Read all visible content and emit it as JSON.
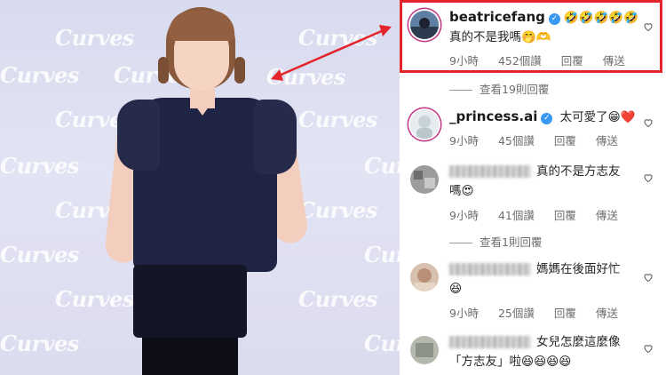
{
  "photo": {
    "watermark_text": "Curves",
    "description_colors": {
      "background": "#dcdcef",
      "shirt": "#1f2444"
    }
  },
  "highlight_color": "#e3242b",
  "comments": [
    {
      "username": "beatricefang",
      "verified": true,
      "text_prefix": "",
      "text": "真的不是我嗎",
      "emoji_after_name": "🤣🤣🤣🤣🤣",
      "emoji_after_text": "🤭🫶",
      "time": "9小時",
      "likes": "452個讚",
      "reply": "回覆",
      "send": "傳送"
    },
    {
      "view_replies": "查看19則回覆"
    },
    {
      "username": "_princess.ai",
      "verified": true,
      "text": "太可愛了",
      "emoji_after_text": "😁❤️",
      "time": "9小時",
      "likes": "45個讚",
      "reply": "回覆",
      "send": "傳送"
    },
    {
      "username_blurred": true,
      "text": "真的不是方志友",
      "text_line2": "嗎",
      "emoji_after_text": "😍",
      "time": "9小時",
      "likes": "41個讚",
      "reply": "回覆",
      "send": "傳送"
    },
    {
      "view_replies": "查看1則回覆"
    },
    {
      "username_blurred": true,
      "text": "媽媽在後面好忙",
      "emoji_line2": "😆",
      "time": "9小時",
      "likes": "25個讚",
      "reply": "回覆",
      "send": "傳送"
    },
    {
      "username_blurred": true,
      "text": "女兒怎麼這麼像",
      "text_line2": "「方志友」啦",
      "emoji_after_text": "😆😆😆😆"
    }
  ],
  "icons": {
    "heart": "heart-outline-icon",
    "verified": "verified-badge-icon"
  }
}
